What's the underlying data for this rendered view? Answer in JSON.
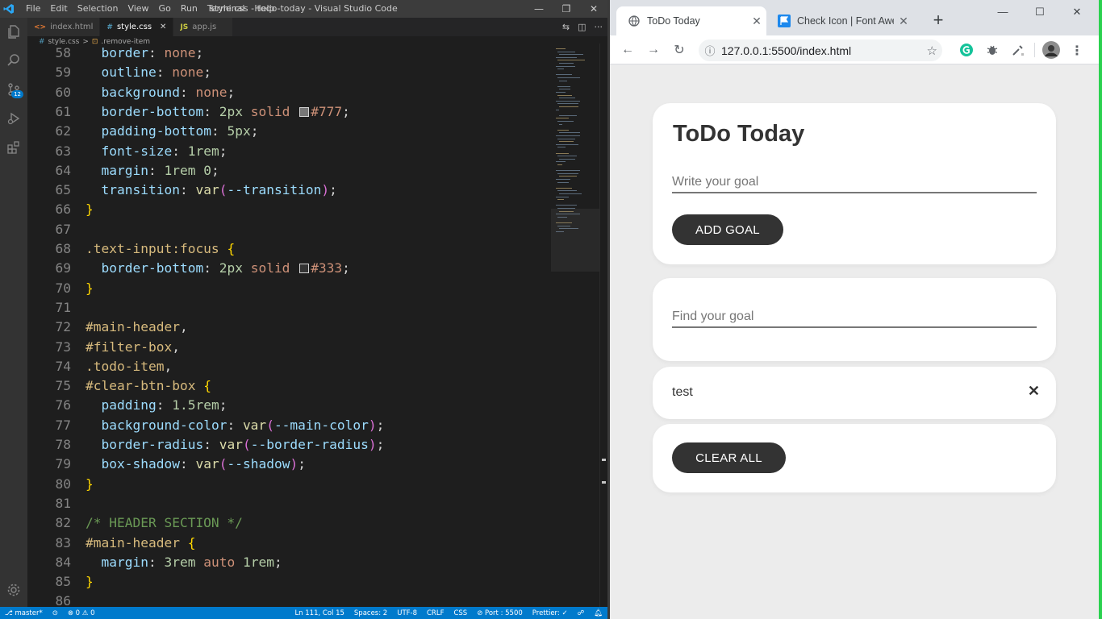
{
  "vscode": {
    "title": "style.css - todo-today - Visual Studio Code",
    "menu": [
      "File",
      "Edit",
      "Selection",
      "View",
      "Go",
      "Run",
      "Terminal",
      "Help"
    ],
    "window_controls": [
      "—",
      "❐",
      "✕"
    ],
    "activity_badge": "12",
    "tabs": [
      {
        "icon": "<>",
        "label": "index.html",
        "active": false,
        "icon_color": "#e37933"
      },
      {
        "icon": "#",
        "label": "style.css",
        "active": true,
        "icon_color": "#519aba"
      },
      {
        "icon": "JS",
        "label": "app.js",
        "active": false,
        "icon_color": "#cbcb41"
      }
    ],
    "breadcrumb": {
      "file": "style.css",
      "separator": ">",
      "symbol": ".remove-item"
    },
    "code_lines": [
      {
        "n": "58",
        "html": "  <span class=\"tk-prop\">border</span><span class=\"tk-p\">: </span><span class=\"tk-val\">none</span><span class=\"tk-p\">;</span>"
      },
      {
        "n": "59",
        "html": "  <span class=\"tk-prop\">outline</span><span class=\"tk-p\">: </span><span class=\"tk-val\">none</span><span class=\"tk-p\">;</span>"
      },
      {
        "n": "60",
        "html": "  <span class=\"tk-prop\">background</span><span class=\"tk-p\">: </span><span class=\"tk-val\">none</span><span class=\"tk-p\">;</span>"
      },
      {
        "n": "61",
        "html": "  <span class=\"tk-prop\">border-bottom</span><span class=\"tk-p\">: </span><span class=\"tk-num\">2px</span><span class=\"tk-p\"> </span><span class=\"tk-val\">solid</span><span class=\"tk-p\"> </span><span class=\"swatch\" style=\"background:#777777\"></span><span class=\"tk-val\">#777</span><span class=\"tk-p\">;</span>"
      },
      {
        "n": "62",
        "html": "  <span class=\"tk-prop\">padding-bottom</span><span class=\"tk-p\">: </span><span class=\"tk-num\">5px</span><span class=\"tk-p\">;</span>"
      },
      {
        "n": "63",
        "html": "  <span class=\"tk-prop\">font-size</span><span class=\"tk-p\">: </span><span class=\"tk-num\">1rem</span><span class=\"tk-p\">;</span>"
      },
      {
        "n": "64",
        "html": "  <span class=\"tk-prop\">margin</span><span class=\"tk-p\">: </span><span class=\"tk-num\">1rem</span><span class=\"tk-p\"> </span><span class=\"tk-num\">0</span><span class=\"tk-p\">;</span>"
      },
      {
        "n": "65",
        "html": "  <span class=\"tk-prop\">transition</span><span class=\"tk-p\">: </span><span class=\"tk-fn\">var</span><span class=\"tk-pn\">(</span><span class=\"tk-var\">--transition</span><span class=\"tk-pn\">)</span><span class=\"tk-p\">;</span>"
      },
      {
        "n": "66",
        "html": "<span class=\"tk-br\">}</span>"
      },
      {
        "n": "67",
        "html": ""
      },
      {
        "n": "68",
        "html": "<span class=\"tk-sel\">.text-input:focus</span><span class=\"tk-p\"> </span><span class=\"tk-br\">{</span>"
      },
      {
        "n": "69",
        "html": "  <span class=\"tk-prop\">border-bottom</span><span class=\"tk-p\">: </span><span class=\"tk-num\">2px</span><span class=\"tk-p\"> </span><span class=\"tk-val\">solid</span><span class=\"tk-p\"> </span><span class=\"swatch\" style=\"background:#333333\"></span><span class=\"tk-val\">#333</span><span class=\"tk-p\">;</span>"
      },
      {
        "n": "70",
        "html": "<span class=\"tk-br\">}</span>"
      },
      {
        "n": "71",
        "html": ""
      },
      {
        "n": "72",
        "html": "<span class=\"tk-sel\">#main-header</span><span class=\"tk-p\">,</span>"
      },
      {
        "n": "73",
        "html": "<span class=\"tk-sel\">#filter-box</span><span class=\"tk-p\">,</span>"
      },
      {
        "n": "74",
        "html": "<span class=\"tk-sel\">.todo-item</span><span class=\"tk-p\">,</span>"
      },
      {
        "n": "75",
        "html": "<span class=\"tk-sel\">#clear-btn-box</span><span class=\"tk-p\"> </span><span class=\"tk-br\">{</span>"
      },
      {
        "n": "76",
        "html": "  <span class=\"tk-prop\">padding</span><span class=\"tk-p\">: </span><span class=\"tk-num\">1.5rem</span><span class=\"tk-p\">;</span>"
      },
      {
        "n": "77",
        "html": "  <span class=\"tk-prop\">background-color</span><span class=\"tk-p\">: </span><span class=\"tk-fn\">var</span><span class=\"tk-pn\">(</span><span class=\"tk-var\">--main-color</span><span class=\"tk-pn\">)</span><span class=\"tk-p\">;</span>"
      },
      {
        "n": "78",
        "html": "  <span class=\"tk-prop\">border-radius</span><span class=\"tk-p\">: </span><span class=\"tk-fn\">var</span><span class=\"tk-pn\">(</span><span class=\"tk-var\">--border-radius</span><span class=\"tk-pn\">)</span><span class=\"tk-p\">;</span>"
      },
      {
        "n": "79",
        "html": "  <span class=\"tk-prop\">box-shadow</span><span class=\"tk-p\">: </span><span class=\"tk-fn\">var</span><span class=\"tk-pn\">(</span><span class=\"tk-var\">--shadow</span><span class=\"tk-pn\">)</span><span class=\"tk-p\">;</span>"
      },
      {
        "n": "80",
        "html": "<span class=\"tk-br\">}</span>"
      },
      {
        "n": "81",
        "html": ""
      },
      {
        "n": "82",
        "html": "<span class=\"tk-com\">/* HEADER SECTION */</span>"
      },
      {
        "n": "83",
        "html": "<span class=\"tk-sel\">#main-header</span><span class=\"tk-p\"> </span><span class=\"tk-br\">{</span>"
      },
      {
        "n": "84",
        "html": "  <span class=\"tk-prop\">margin</span><span class=\"tk-p\">: </span><span class=\"tk-num\">3rem</span><span class=\"tk-p\"> </span><span class=\"tk-val\">auto</span><span class=\"tk-p\"> </span><span class=\"tk-num\">1rem</span><span class=\"tk-p\">;</span>"
      },
      {
        "n": "85",
        "html": "<span class=\"tk-br\">}</span>"
      },
      {
        "n": "86",
        "html": ""
      }
    ],
    "status": {
      "branch": "master*",
      "sync": "⊙",
      "problems": "⊗ 0  ⚠ 0",
      "cursor": "Ln 111, Col 15",
      "spaces": "Spaces: 2",
      "encoding": "UTF-8",
      "eol": "CRLF",
      "language": "CSS",
      "port": "⊘ Port : 5500",
      "prettier": "Prettier: ✓"
    }
  },
  "chrome": {
    "tabs": [
      {
        "label": "ToDo Today",
        "active": true
      },
      {
        "label": "Check Icon | Font Awesome",
        "active": false
      }
    ],
    "new_tab": "+",
    "window_controls": [
      "—",
      "☐",
      "✕"
    ],
    "url": "127.0.0.1:5500/index.html",
    "colors": {
      "accent_blue": "#1a73e8",
      "fontawesome_blue": "#1c88ed",
      "grammarly_green": "#15c39a"
    }
  },
  "app": {
    "title": "ToDo Today",
    "goal_placeholder": "Write your goal",
    "add_button": "ADD GOAL",
    "filter_placeholder": "Find your goal",
    "todos": [
      {
        "text": "test",
        "remove_icon": "✕"
      }
    ],
    "clear_button": "CLEAR ALL",
    "colors": {
      "main_color": "#ffffff",
      "background": "#ececec",
      "text": "#333333",
      "input_border": "#777777"
    }
  }
}
